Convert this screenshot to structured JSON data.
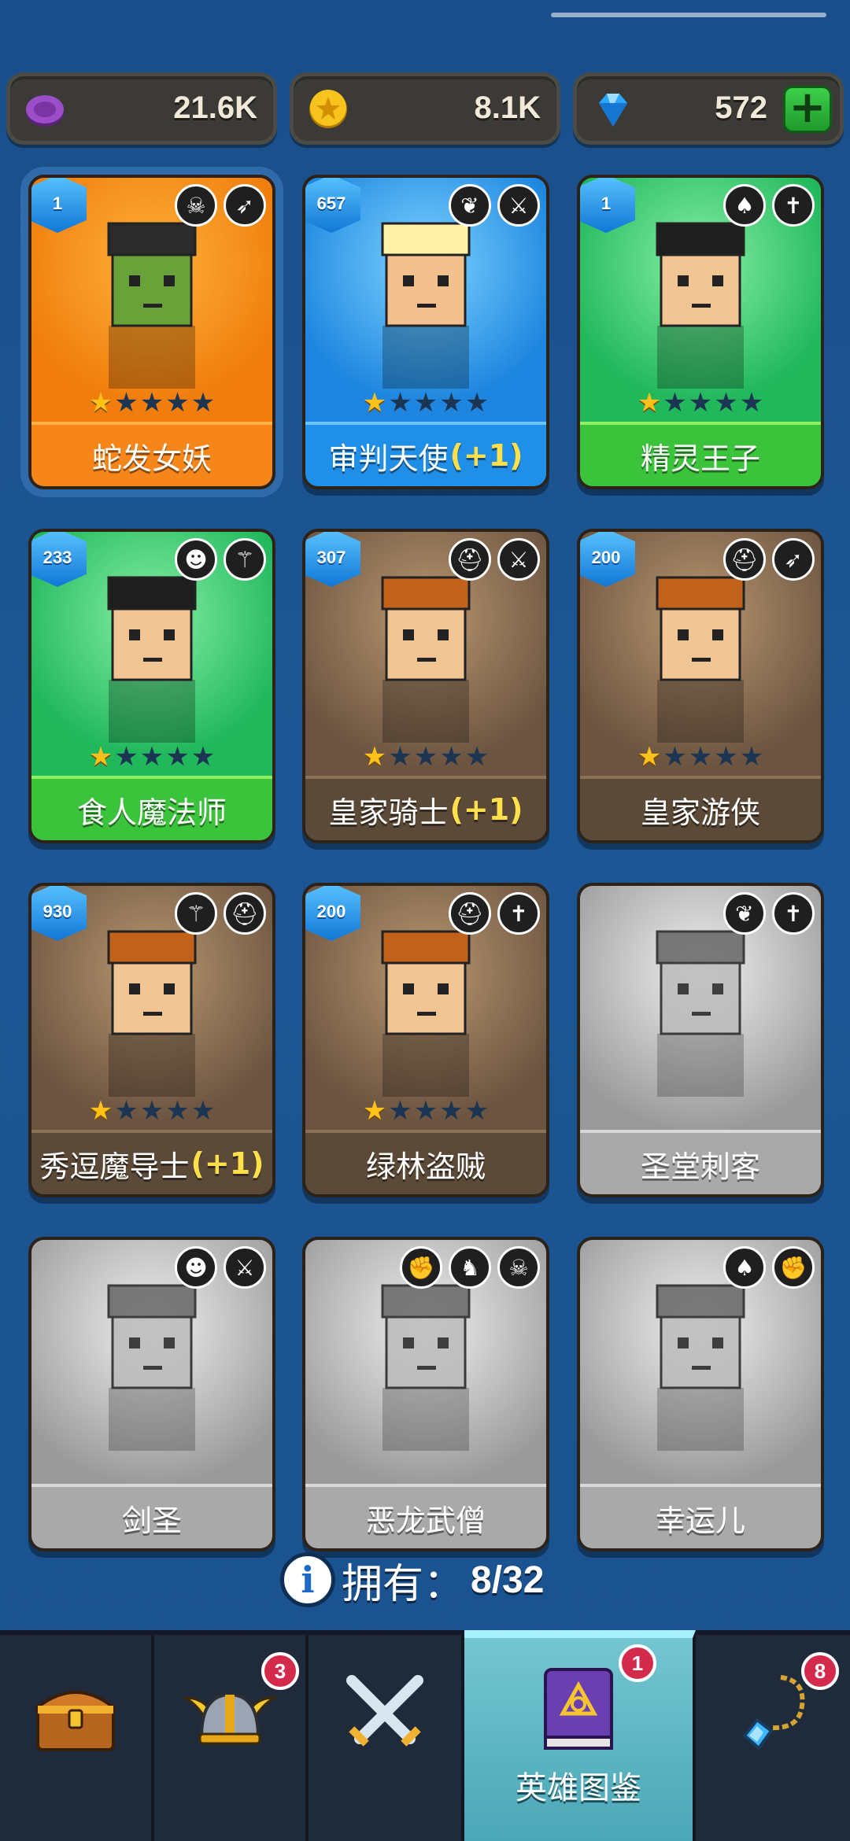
{
  "currencies": [
    {
      "name": "elixir",
      "value": "21.6K",
      "icon": "purple-coin-icon",
      "color": "#8e44ad"
    },
    {
      "name": "gold",
      "value": "8.1K",
      "icon": "gold-coin-icon",
      "color": "#f4b400"
    },
    {
      "name": "gems",
      "value": "572",
      "icon": "blue-gem-icon",
      "color": "#2aa6ff",
      "add_label": "+"
    }
  ],
  "heroes": [
    {
      "name": "蛇发女妖",
      "bonus": "",
      "level": "1",
      "rarity": "orange",
      "stars": 1,
      "roles": [
        "skull-icon",
        "bow-icon"
      ],
      "owned": true,
      "selected": true
    },
    {
      "name": "审判天使",
      "bonus": "(+1)",
      "level": "657",
      "rarity": "blue",
      "stars": 1,
      "roles": [
        "wings-icon",
        "sword-icon"
      ],
      "owned": true
    },
    {
      "name": "精灵王子",
      "bonus": "",
      "level": "1",
      "rarity": "green",
      "stars": 1,
      "roles": [
        "elf-icon",
        "dagger-icon"
      ],
      "owned": true
    },
    {
      "name": "食人魔法师",
      "bonus": "",
      "level": "233",
      "rarity": "green",
      "stars": 1,
      "roles": [
        "ogre-icon",
        "staff-icon"
      ],
      "owned": true
    },
    {
      "name": "皇家骑士",
      "bonus": "(+1)",
      "level": "307",
      "rarity": "brown",
      "stars": 1,
      "roles": [
        "helmet-icon",
        "sword-icon"
      ],
      "owned": true
    },
    {
      "name": "皇家游侠",
      "bonus": "",
      "level": "200",
      "rarity": "brown",
      "stars": 1,
      "roles": [
        "helmet-icon",
        "bow-icon"
      ],
      "owned": true
    },
    {
      "name": "秀逗魔导士",
      "bonus": "(+1)",
      "level": "930",
      "rarity": "brown",
      "stars": 1,
      "roles": [
        "staff-icon",
        "helmet-icon"
      ],
      "owned": true
    },
    {
      "name": "绿林盗贼",
      "bonus": "",
      "level": "200",
      "rarity": "brown",
      "stars": 1,
      "roles": [
        "helmet-icon",
        "dagger-icon"
      ],
      "owned": true
    },
    {
      "name": "圣堂刺客",
      "bonus": "",
      "level": "",
      "rarity": "gray",
      "stars": 0,
      "roles": [
        "wings-icon",
        "dagger-icon"
      ],
      "owned": false
    },
    {
      "name": "剑圣",
      "bonus": "",
      "level": "",
      "rarity": "gray",
      "stars": 0,
      "roles": [
        "ogre-icon",
        "sword-icon"
      ],
      "owned": false
    },
    {
      "name": "恶龙武僧",
      "bonus": "",
      "level": "",
      "rarity": "gray",
      "stars": 0,
      "roles": [
        "fist-icon",
        "dragon-icon",
        "skull-icon"
      ],
      "owned": false
    },
    {
      "name": "幸运儿",
      "bonus": "",
      "level": "",
      "rarity": "gray",
      "stars": 0,
      "roles": [
        "elf-icon",
        "fist-icon"
      ],
      "owned": false
    }
  ],
  "owned_summary": {
    "label": "拥有：",
    "count": "8/32"
  },
  "nav": [
    {
      "name": "shop",
      "icon": "treasure-chest-icon",
      "label": "",
      "badge": ""
    },
    {
      "name": "heroes",
      "icon": "viking-helmet-icon",
      "label": "",
      "badge": "3"
    },
    {
      "name": "battle",
      "icon": "crossed-swords-icon",
      "label": "",
      "badge": ""
    },
    {
      "name": "codex",
      "icon": "spellbook-icon",
      "label": "英雄图鉴",
      "badge": "1",
      "active": true
    },
    {
      "name": "items",
      "icon": "amulet-icon",
      "label": "",
      "badge": "8"
    }
  ]
}
